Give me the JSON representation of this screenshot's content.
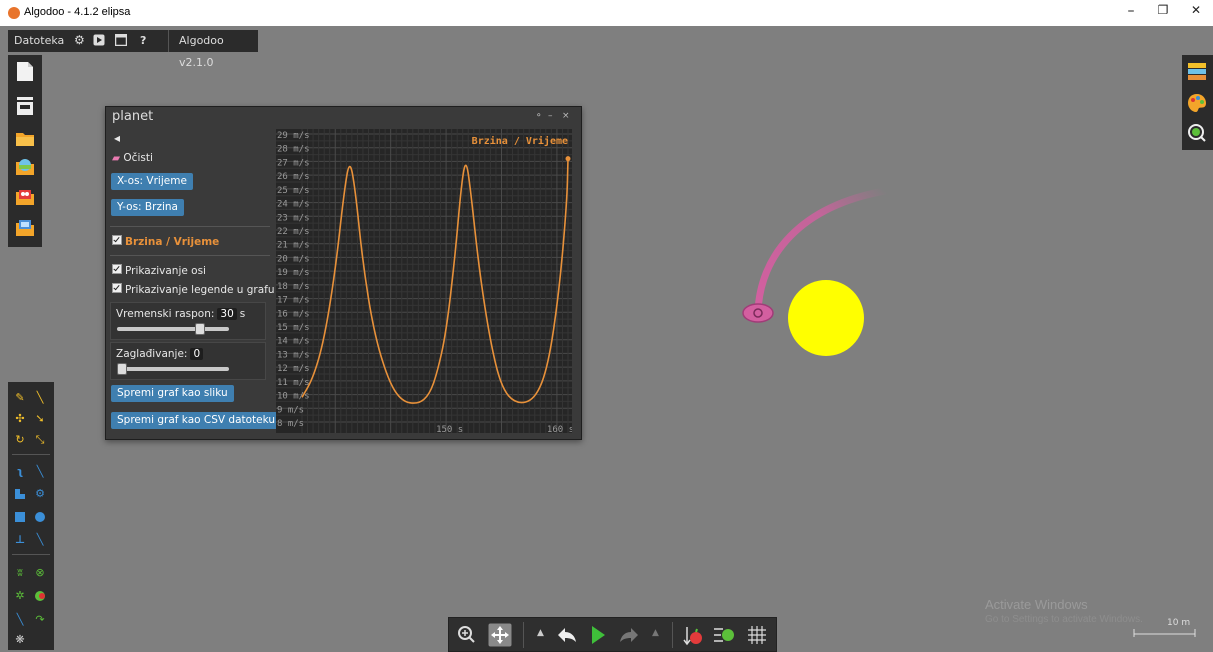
{
  "window": {
    "title": "Algodoo - 4.1.2 elipsa",
    "minimize": "–",
    "maximize": "❐",
    "close": "✕"
  },
  "topmenu": {
    "file": "Datoteka",
    "help": "?",
    "version": "Algodoo v2.1.0"
  },
  "panel": {
    "title": "planet",
    "back": "◂",
    "clear": "Očisti",
    "x_axis_button": "X-os: Vrijeme",
    "y_axis_button": "Y-os: Brzina",
    "series_label": "Brzina / Vrijeme",
    "show_axes": "Prikazivanje osi",
    "show_legend": "Prikazivanje legende u grafu",
    "time_range_label": "Vremenski raspon:",
    "time_range_value": "30",
    "time_range_unit": "s",
    "smoothing_label": "Zaglađivanje:",
    "smoothing_value": "0",
    "save_image": "Spremi graf kao sliku",
    "save_csv": "Spremi graf kao CSV datoteku",
    "controls": [
      "⚬",
      "–",
      "×"
    ]
  },
  "chart_data": {
    "type": "line",
    "title": "Brzina / Vrijeme",
    "y_ticks": [
      "29 m/s",
      "28 m/s",
      "27 m/s",
      "26 m/s",
      "25 m/s",
      "24 m/s",
      "23 m/s",
      "22 m/s",
      "21 m/s",
      "20 m/s",
      "19 m/s",
      "18 m/s",
      "17 m/s",
      "16 m/s",
      "15 m/s",
      "14 m/s",
      "13 m/s",
      "12 m/s",
      "11 m/s",
      "10 m/s",
      "9 m/s",
      "8 m/s"
    ],
    "x_ticks": [
      "150 s",
      "160 s"
    ],
    "ylim": [
      8,
      29
    ],
    "xlim": [
      137,
      161
    ],
    "color": "#e8913a",
    "series": [
      {
        "x": [
          137,
          138,
          139,
          140,
          140.8,
          141.3,
          141.8,
          142.5,
          143.5,
          144.8,
          146,
          147.5,
          148.5,
          149.2,
          150,
          150.8,
          151.4,
          151.8,
          152.2,
          153,
          154,
          155,
          156.3,
          158,
          159.2,
          160.2,
          160.9,
          161
        ],
        "y": [
          9.8,
          11.2,
          14,
          19,
          24.8,
          27.2,
          25,
          19.5,
          14.5,
          11,
          9.5,
          9.3,
          10,
          11.6,
          14.5,
          20,
          25.5,
          27.2,
          25,
          19,
          13.8,
          10.5,
          9.3,
          9.6,
          12,
          17.5,
          24,
          27.2
        ]
      }
    ]
  },
  "scene": {
    "sun_color": "#ffff00",
    "trail_color": "#d35fa0"
  },
  "watermark": {
    "line1": "Activate Windows",
    "line2": "Go to Settings to activate Windows."
  },
  "scale_label": "10 m"
}
